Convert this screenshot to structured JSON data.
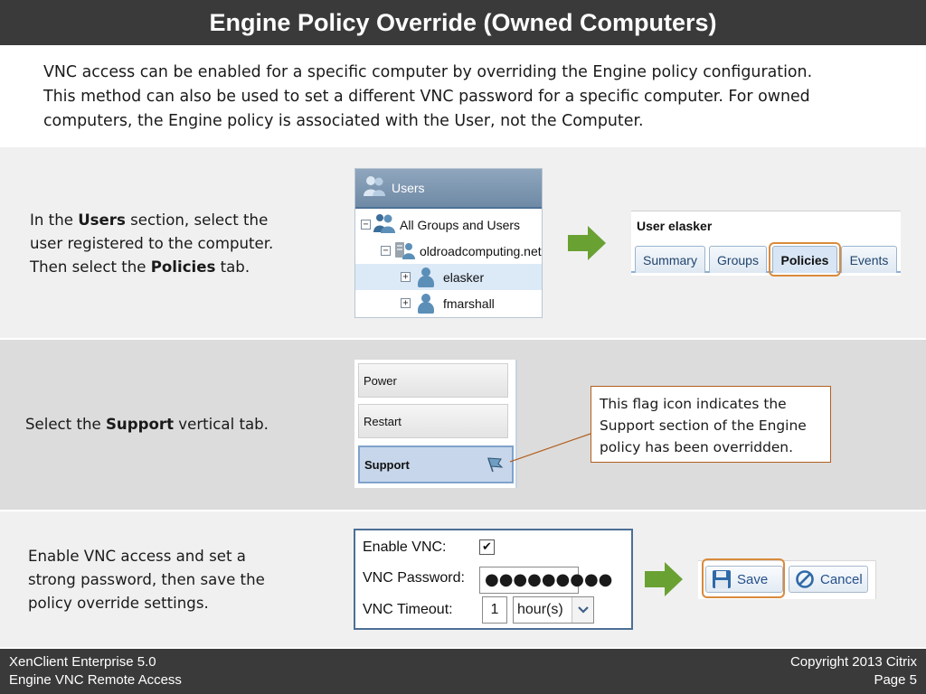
{
  "title": "Engine Policy Override (Owned Computers)",
  "intro": {
    "line1": "VNC access can be enabled for a specific computer by overriding the Engine policy configuration.",
    "line2": "This method can also be used to set a different VNC password for a specific computer.  For owned",
    "line3": "computers, the Engine policy is associated with the User, not the Computer."
  },
  "step1": {
    "text": {
      "a": "In the ",
      "b": "Users",
      "c": " section, select the",
      "d": "user registered to the computer.",
      "e": "Then select the ",
      "f": "Policies",
      "g": " tab."
    },
    "users_panel": {
      "header": "Users",
      "items": [
        {
          "label": "All Groups and Users",
          "icon": "users-group-icon"
        },
        {
          "label": "oldroadcomputing.net",
          "icon": "domain-server-icon"
        },
        {
          "label": "elasker",
          "icon": "user-icon",
          "selected": true
        },
        {
          "label": "fmarshall",
          "icon": "user-icon"
        }
      ]
    },
    "user_panel": {
      "title": "User elasker",
      "tabs": [
        "Summary",
        "Groups",
        "Policies",
        "Events"
      ],
      "active_tab": "Policies"
    }
  },
  "step2": {
    "text": {
      "a": "Select the ",
      "b": "Support",
      "c": " vertical tab."
    },
    "vertical_tabs": [
      "Power",
      "Restart",
      "Support"
    ],
    "active_tab": "Support",
    "callout": {
      "line1": "This flag icon indicates the",
      "line2": "Support section of the Engine",
      "line3": "policy has been overridden."
    }
  },
  "step3": {
    "text": {
      "line1": "Enable VNC access and set a",
      "line2": "strong password, then save the",
      "line3": "policy override settings."
    },
    "form": {
      "enable_label": "Enable VNC:",
      "enable_checked": true,
      "check_mark": "✔",
      "password_label": "VNC Password:",
      "password_value": "●●●●●●●●●",
      "timeout_label": "VNC Timeout:",
      "timeout_value": "1",
      "timeout_unit": "hour(s)"
    },
    "buttons": {
      "save": "Save",
      "cancel": "Cancel"
    }
  },
  "footer": {
    "product": "XenClient Enterprise 5.0",
    "subtitle": "Engine VNC Remote Access",
    "copyright": "Copyright 2013 Citrix",
    "page": "Page 5"
  },
  "colors": {
    "title_bar": "#3a3a3a",
    "arrow_green": "#6aa133",
    "highlight_orange": "#d98a3c",
    "callout_border": "#b25f1f",
    "panel_header": "#7891ab"
  }
}
